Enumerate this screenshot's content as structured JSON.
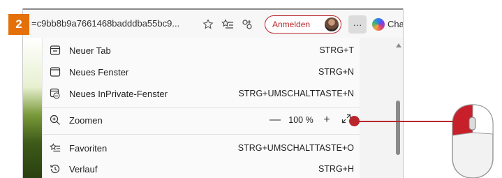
{
  "step": {
    "number": "2",
    "color": "#e4700a"
  },
  "toolbar": {
    "url_text": "=c9bb8b9a7661468badddba55bc9...",
    "favorite_icon": "star-outline-icon",
    "favorites_icon": "favorites-list-icon",
    "extensions_icon": "extensions-icon",
    "signin_label": "Anmelden",
    "more_label": "···",
    "chat_label": "Chat",
    "accent_color": "#b9262c"
  },
  "menu": {
    "items": [
      {
        "icon": "new-tab-icon",
        "label": "Neuer Tab",
        "shortcut": "STRG+T"
      },
      {
        "icon": "new-window-icon",
        "label": "Neues Fenster",
        "shortcut": "STRG+N"
      },
      {
        "icon": "inprivate-window-icon",
        "label": "Neues InPrivate-Fenster",
        "shortcut": "STRG+UMSCHALTTASTE+N"
      }
    ],
    "zoom": {
      "icon": "zoom-icon",
      "label": "Zoomen",
      "minus": "—",
      "value": "100 %",
      "plus": "+",
      "fullscreen_icon": "fullscreen-icon"
    },
    "items2": [
      {
        "icon": "favorites-icon",
        "label": "Favoriten",
        "shortcut": "STRG+UMSCHALTTASTE+O"
      },
      {
        "icon": "history-icon",
        "label": "Verlauf",
        "shortcut": "STRG+H"
      }
    ]
  }
}
